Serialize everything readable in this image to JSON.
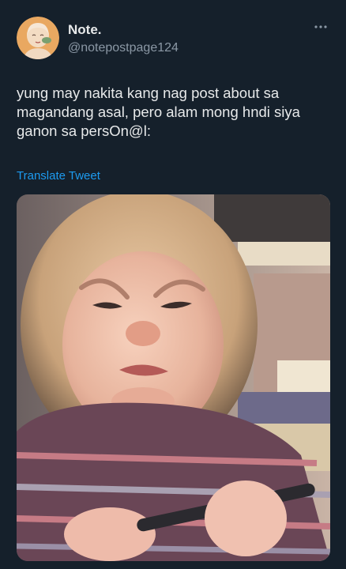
{
  "author": {
    "display_name": "Note.",
    "handle": "@notepostpage124"
  },
  "tweet": {
    "text": "yung may nakita kang nag post about sa\nmagandang asal, pero alam mong hndi siya\nganon sa persOn@l:",
    "translate_label": "Translate Tweet"
  },
  "icons": {
    "more": "more-horizontal-icon",
    "avatar": "avatar-illustration"
  },
  "colors": {
    "background": "#15202b",
    "primary_text": "#e7e9ea",
    "secondary_text": "#8b98a5",
    "link": "#1d9bf0"
  }
}
